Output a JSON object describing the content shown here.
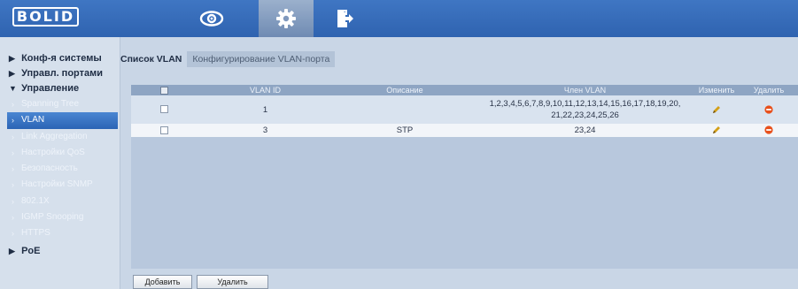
{
  "header": {
    "logo": "BOLID",
    "nav": [
      {
        "icon": "eye-icon"
      },
      {
        "icon": "gear-icon"
      },
      {
        "icon": "logout-icon"
      }
    ]
  },
  "sidebar": {
    "groups": [
      {
        "label": "Конф-я системы",
        "expanded": false
      },
      {
        "label": "Управл. портами",
        "expanded": false
      },
      {
        "label": "Управление",
        "expanded": true
      },
      {
        "label": "PoE",
        "expanded": false
      }
    ],
    "items": [
      {
        "label": "Spanning Tree"
      },
      {
        "label": "VLAN"
      },
      {
        "label": "Link Aggregation"
      },
      {
        "label": "Настройки QoS"
      },
      {
        "label": "Безопасность"
      },
      {
        "label": "Настройки SNMP"
      },
      {
        "label": "802.1X"
      },
      {
        "label": "IGMP Snooping"
      },
      {
        "label": "HTTPS"
      }
    ]
  },
  "tabs": [
    {
      "label": "Список VLAN"
    },
    {
      "label": "Конфигурирование VLAN-порта"
    }
  ],
  "table": {
    "headers": [
      "VLAN ID",
      "Описание",
      "Член VLAN",
      "Изменить",
      "Удалить"
    ],
    "rows": [
      {
        "id": "1",
        "description": "",
        "members_line1": "1,2,3,4,5,6,7,8,9,10,11,12,13,14,15,16,17,18,19,20,",
        "members_line2": "21,22,23,24,25,26"
      },
      {
        "id": "3",
        "description": "STP",
        "members_line1": "23,24",
        "members_line2": ""
      }
    ]
  },
  "buttons": {
    "add": "Добавить",
    "delete": "Удалить"
  },
  "colors": {
    "topbar": "#2f63b0",
    "active_nav": "#4a86d2",
    "delete_icon": "#e8501c",
    "edit_icon": "#d4a017"
  }
}
